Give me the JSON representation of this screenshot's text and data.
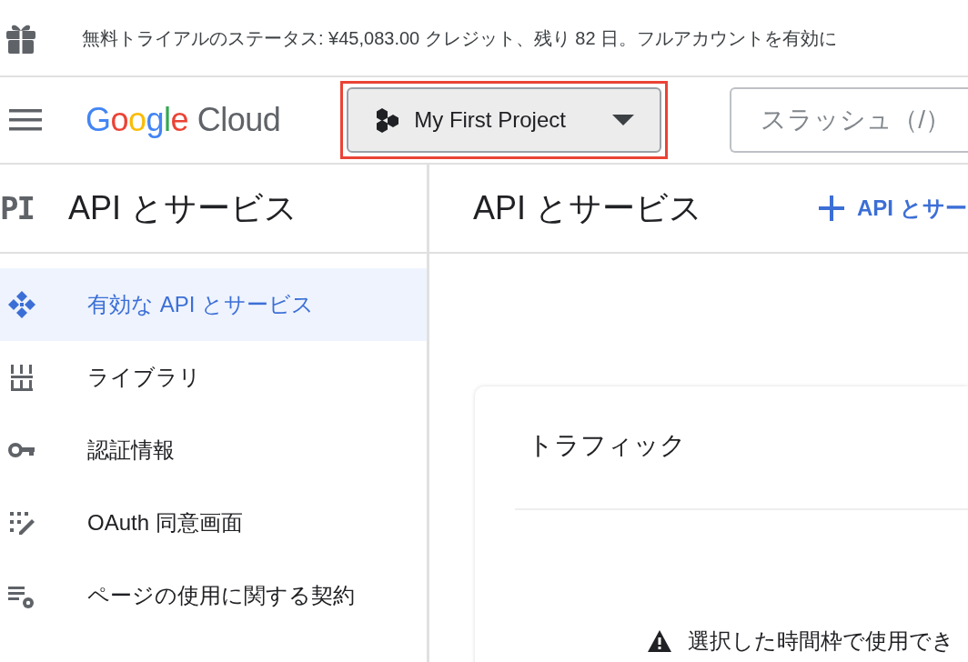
{
  "banner": {
    "text": "無料トライアルのステータス: ¥45,083.00 クレジット、残り 82 日。フルアカウントを有効に"
  },
  "header": {
    "logo": {
      "brand": "Google",
      "product": "Cloud"
    },
    "project_selector": {
      "label": "My First Project",
      "highlighted": true
    },
    "search": {
      "placeholder": "スラッシュ（/）"
    }
  },
  "sidebar": {
    "badge": "PI",
    "title": "API とサービス",
    "items": [
      {
        "kind": "enabled",
        "label": "有効な API とサービス",
        "selected": true
      },
      {
        "kind": "library",
        "label": "ライブラリ",
        "selected": false
      },
      {
        "kind": "credentials",
        "label": "認証情報",
        "selected": false
      },
      {
        "kind": "consent",
        "label": "OAuth 同意画面",
        "selected": false
      },
      {
        "kind": "agreements",
        "label": "ページの使用に関する契約",
        "selected": false
      }
    ]
  },
  "main": {
    "title": "API とサービス",
    "action": "API とサー",
    "card": {
      "title": "トラフィック",
      "warning": "選択した時間枠で使用でき"
    }
  }
}
